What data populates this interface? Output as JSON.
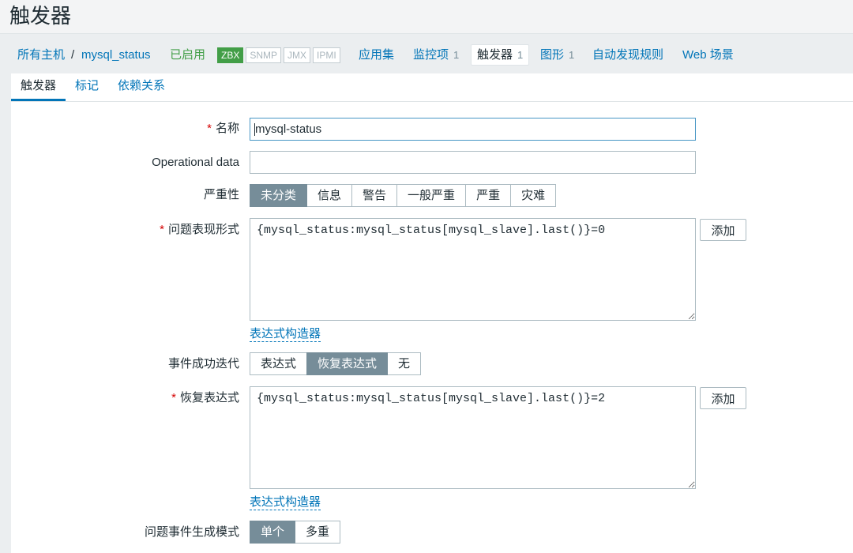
{
  "page": {
    "title": "触发器"
  },
  "host_nav": {
    "all_hosts": "所有主机",
    "separator": "/",
    "host": "mysql_status",
    "status": "已启用",
    "availability": [
      {
        "label": "ZBX",
        "active": true
      },
      {
        "label": "SNMP",
        "active": false
      },
      {
        "label": "JMX",
        "active": false
      },
      {
        "label": "IPMI",
        "active": false
      }
    ],
    "links": [
      {
        "label": "应用集",
        "selected": false
      },
      {
        "label": "监控项",
        "count": "1",
        "selected": false
      },
      {
        "label": "触发器",
        "count": "1",
        "selected": true
      },
      {
        "label": "图形",
        "count": "1",
        "selected": false
      },
      {
        "label": "自动发现规则",
        "selected": false
      },
      {
        "label": "Web 场景",
        "selected": false
      }
    ]
  },
  "tabs": [
    {
      "label": "触发器",
      "active": true
    },
    {
      "label": "标记",
      "active": false
    },
    {
      "label": "依赖关系",
      "active": false
    }
  ],
  "form": {
    "required_mark": "*",
    "name": {
      "label": "名称",
      "required": true,
      "value": "mysql-status"
    },
    "operational_data": {
      "label": "Operational data",
      "required": false,
      "value": ""
    },
    "severity": {
      "label": "严重性",
      "options": [
        {
          "label": "未分类",
          "selected": true
        },
        {
          "label": "信息",
          "selected": false
        },
        {
          "label": "警告",
          "selected": false
        },
        {
          "label": "一般严重",
          "selected": false
        },
        {
          "label": "严重",
          "selected": false
        },
        {
          "label": "灾难",
          "selected": false
        }
      ]
    },
    "problem_expression": {
      "label": "问题表现形式",
      "required": true,
      "value": "{mysql_status:mysql_status[mysql_slave].last()}=0",
      "add_button": "添加",
      "builder_link": "表达式构造器"
    },
    "ok_event_generation": {
      "label": "事件成功迭代",
      "options": [
        {
          "label": "表达式",
          "selected": false
        },
        {
          "label": "恢复表达式",
          "selected": true
        },
        {
          "label": "无",
          "selected": false
        }
      ]
    },
    "recovery_expression": {
      "label": "恢复表达式",
      "required": true,
      "value": "{mysql_status:mysql_status[mysql_slave].last()}=2",
      "add_button": "添加",
      "builder_link": "表达式构造器"
    },
    "problem_event_mode": {
      "label": "问题事件生成模式",
      "options": [
        {
          "label": "单个",
          "selected": true
        },
        {
          "label": "多重",
          "selected": false
        }
      ]
    }
  },
  "colors": {
    "link": "#0275b8",
    "text": "#1f2c33",
    "enabled": "#429e47",
    "required": "#d40000",
    "segment_selected": "#768d99",
    "input_focus": "#4796c4"
  }
}
